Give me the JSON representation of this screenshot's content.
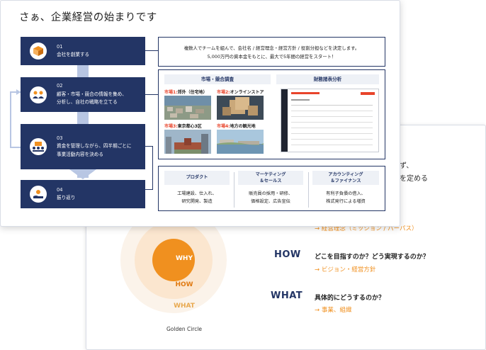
{
  "back_slide": {
    "peek_lines": [
      "ず、",
      "を定める"
    ],
    "partial_answer": "→ 経営理念（ミッション / パーパス）",
    "circle_labels": {
      "why": "WHY",
      "how": "HOW",
      "what": "WHAT"
    },
    "caption": "Golden Circle",
    "rows": [
      {
        "key": "HOW",
        "question": "どこを目指すのか？どう実現するのか？",
        "answer": "→ ビジョン・経営方針"
      },
      {
        "key": "WHAT",
        "question": "具体的にどうするのか？",
        "answer": "→ 事業、組織"
      }
    ]
  },
  "front_slide": {
    "title": "さぁ、企業経営の始まりです",
    "steps": [
      {
        "num": "01",
        "lines": [
          "会社を創業する"
        ],
        "icon": "cube-icon"
      },
      {
        "num": "02",
        "lines": [
          "顧客・市場・競合の情報を集め、",
          "分析し、自社の戦略を立てる"
        ],
        "icon": "team-icon"
      },
      {
        "num": "03",
        "lines": [
          "資金を管理しながら、四半期ごとに",
          "事業活動内容を決める"
        ],
        "icon": "meeting-icon"
      },
      {
        "num": "04",
        "lines": [
          "振り返り"
        ],
        "icon": "hand-icon"
      }
    ],
    "intro": {
      "line1": "複数人でチームを組んで、会社名 / 経営理念・経営方針 / 役割分担などを決定します。",
      "line2": "5,000万円の資本金をもとに、最大で5年間の経営をスタート！"
    },
    "research": {
      "market_title": "市場・競合調査",
      "finance_title": "財務諸表分析",
      "markets": [
        {
          "tag": "市場1:",
          "name": "郊外（住宅地）"
        },
        {
          "tag": "市場2:",
          "name": "オンラインストア"
        },
        {
          "tag": "市場3:",
          "name": "東京都心3区"
        },
        {
          "tag": "市場4:",
          "name": "地方の観光地"
        }
      ]
    },
    "activities": [
      {
        "head": [
          "プロダクト"
        ],
        "body": [
          "工場建設、仕入れ、",
          "研究開発、製造"
        ]
      },
      {
        "head": [
          "マーケティング",
          "＆セールス"
        ],
        "body": [
          "販売員の採用・研修、",
          "価格設定、広告宣伝"
        ]
      },
      {
        "head": [
          "アカウンティング",
          "＆ファイナンス"
        ],
        "body": [
          "有利子負債の借入、",
          "株式発行による増資"
        ]
      }
    ]
  },
  "colors": {
    "navy": "#233565",
    "accent_orange": "#f0901f",
    "market_red": "#e8442b",
    "connector": "#b8c6e3"
  }
}
